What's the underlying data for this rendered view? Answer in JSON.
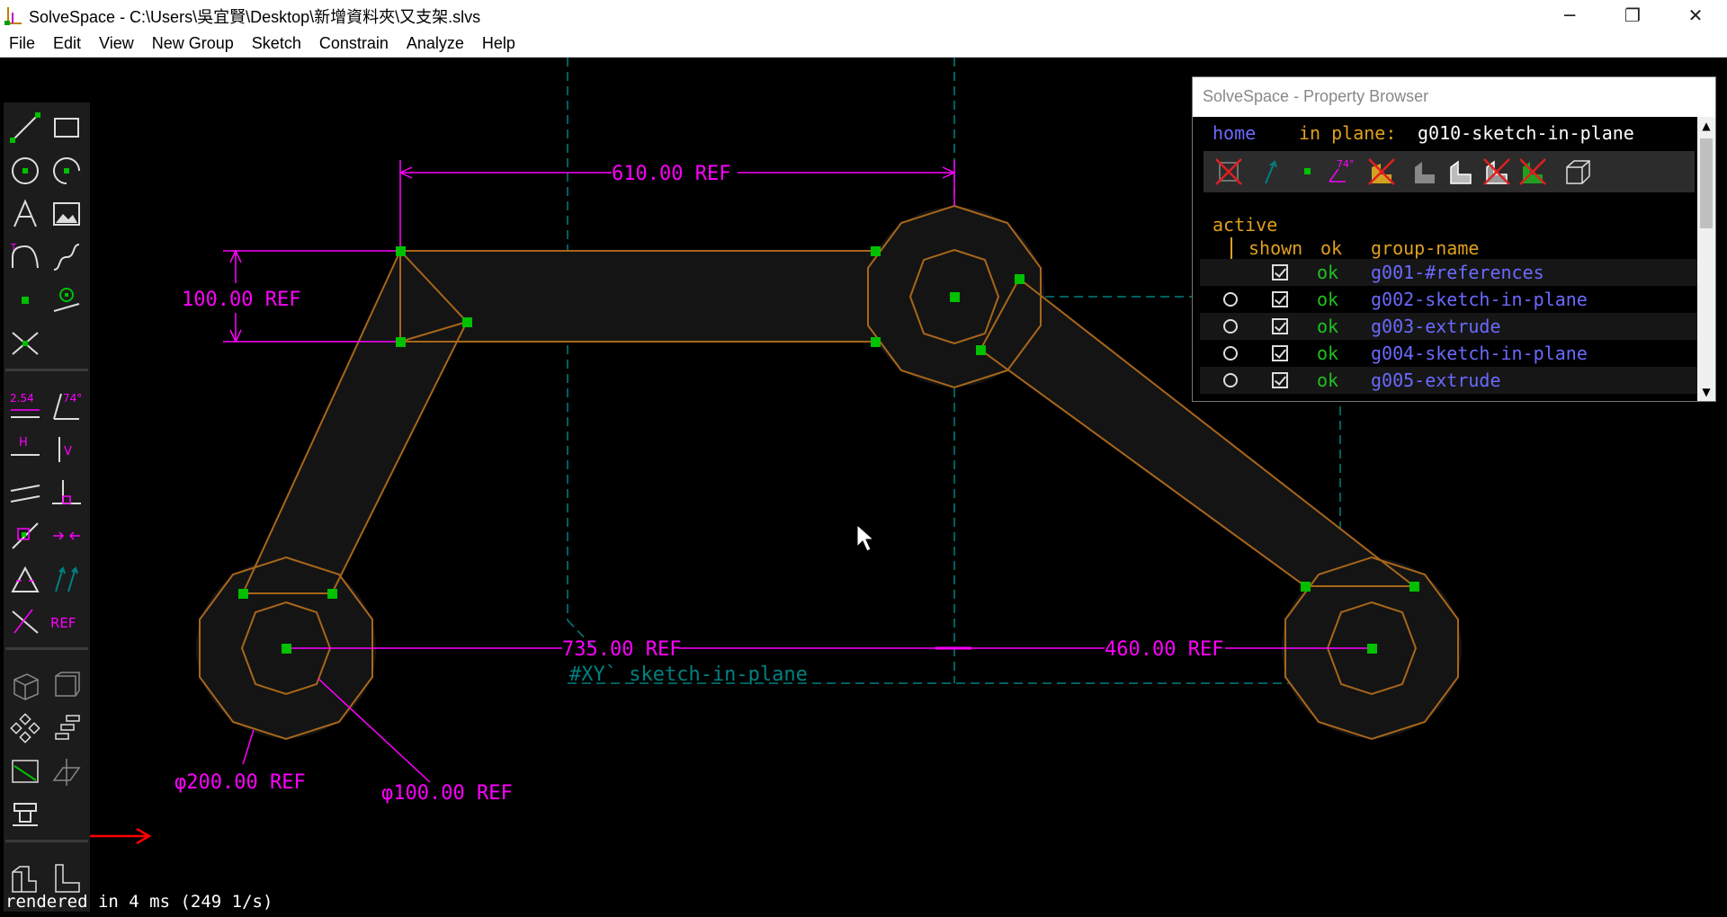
{
  "window": {
    "title": "SolveSpace - C:\\Users\\吳宜賢\\Desktop\\新增資料夾\\又支架.slvs",
    "minimize_glyph": "─",
    "maximize_glyph": "❐",
    "close_glyph": "✕"
  },
  "menu": [
    "File",
    "Edit",
    "View",
    "New Group",
    "Sketch",
    "Constrain",
    "Analyze",
    "Help"
  ],
  "canvas": {
    "dimensions": {
      "top_width": "610.00 REF",
      "arm_height": "100.00 REF",
      "bottom_left": "735.00 REF",
      "bottom_right": "460.00 REF",
      "outer_diameter": "φ200.00 REF",
      "inner_diameter": "φ100.00 REF"
    },
    "workplane_label": "#XY` sketch-in-plane",
    "colors": {
      "background": "#000000",
      "geometry": "#a8661a",
      "constraint": "#ff00ff",
      "point": "#00c000",
      "workplane": "#008080",
      "arrow": "#ff0000"
    }
  },
  "toolbar": {
    "icons": [
      "line-segment",
      "rectangle",
      "circle",
      "arc",
      "text",
      "image",
      "tangent-arc",
      "cubic-spline",
      "datum-point",
      "workplane",
      "split-curves",
      "distance-dimension",
      "angle-dimension",
      "horizontal",
      "vertical",
      "parallel",
      "perpendicular",
      "point-on-line",
      "symmetric",
      "equal-length",
      "same-orientation",
      "other-supplement",
      "reference",
      "nearest-isometric",
      "nearest-ortho",
      "step-translate",
      "step-rotate",
      "sketch-in-3d",
      "sketch-in-workplane",
      "lathe",
      "extrude",
      "revolve"
    ],
    "dim_label": "2.54",
    "angle_label": "74°",
    "ref_label": "REF",
    "h_label": "H",
    "v_label": "V"
  },
  "property_browser": {
    "title": "SolveSpace - Property Browser",
    "home": "home",
    "in_plane_label": "in plane:",
    "in_plane_value": "g010-sketch-in-plane",
    "angle_icon_label": "74°",
    "headers": {
      "active": "active",
      "shown": "shown",
      "ok": "ok",
      "group_name": "group-name"
    },
    "groups": [
      {
        "name": "g001-#references",
        "ok": "ok",
        "has_radio": false
      },
      {
        "name": "g002-sketch-in-plane",
        "ok": "ok",
        "has_radio": true
      },
      {
        "name": "g003-extrude",
        "ok": "ok",
        "has_radio": true
      },
      {
        "name": "g004-sketch-in-plane",
        "ok": "ok",
        "has_radio": true
      },
      {
        "name": "g005-extrude",
        "ok": "ok",
        "has_radio": true
      }
    ]
  },
  "status": {
    "text": "rendered in 4 ms (249 1/s)"
  }
}
